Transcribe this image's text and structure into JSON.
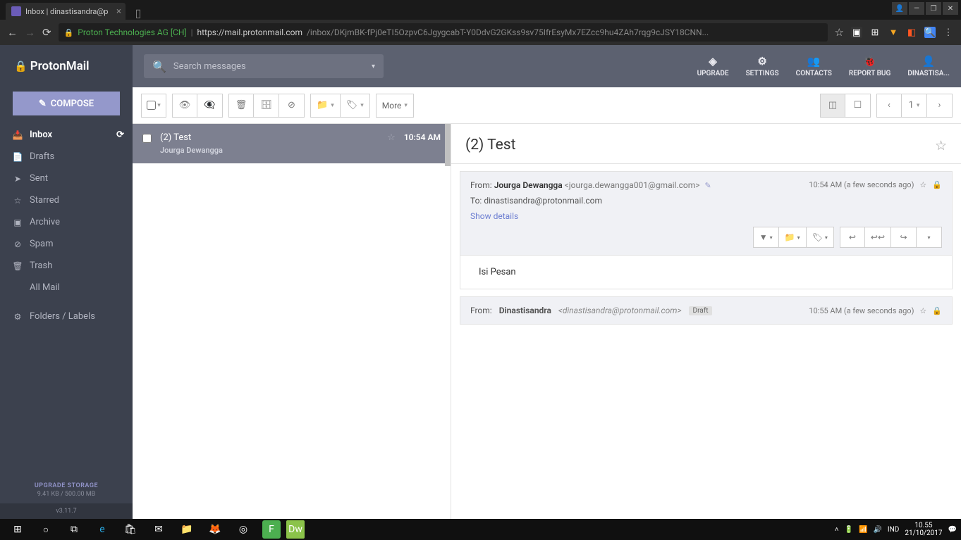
{
  "browser": {
    "tab_title": "Inbox | dinastisandra@p",
    "org": "Proton Technologies AG [CH]",
    "url_host": "https://mail.protonmail.com",
    "url_path": "/inbox/DKjmBK-fPj0eTI5OzpvC6JgygcabT-Y0DdvG2GKss9sv75IfrEsyMx7EZcc9hu4ZAh7rqg9cJSY18CNN..."
  },
  "brand": "ProtonMail",
  "compose_label": "COMPOSE",
  "search_placeholder": "Search messages",
  "top_menu": {
    "upgrade": "UPGRADE",
    "settings": "SETTINGS",
    "contacts": "CONTACTS",
    "report": "REPORT BUG",
    "user": "DINASTISA..."
  },
  "nav": {
    "inbox": "Inbox",
    "drafts": "Drafts",
    "sent": "Sent",
    "starred": "Starred",
    "archive": "Archive",
    "spam": "Spam",
    "trash": "Trash",
    "allmail": "All Mail",
    "folders": "Folders / Labels"
  },
  "storage": {
    "title": "UPGRADE STORAGE",
    "size": "9.41 KB / 500.00 MB"
  },
  "version": "v3.11.7",
  "toolbar": {
    "more": "More",
    "page": "1"
  },
  "list": {
    "item0": {
      "title": "(2) Test",
      "from": "Jourga Dewangga",
      "time": "10:54 AM"
    }
  },
  "detail": {
    "subject": "(2) Test",
    "from_label": "From:",
    "from_name": "Jourga Dewangga",
    "from_addr": "<jourga.dewangga001@gmail.com>",
    "to_label": "To:",
    "to_addr": "dinastisandra@protonmail.com",
    "time": "10:54 AM (a few seconds ago)",
    "show_details": "Show details",
    "body": "Isi Pesan"
  },
  "draft": {
    "from_label": "From:",
    "from_name": "Dinastisandra",
    "from_addr": "<dinastisandra@protonmail.com>",
    "badge": "Draft",
    "time": "10:55 AM (a few seconds ago)"
  },
  "taskbar": {
    "lang": "IND",
    "time": "10.55",
    "date": "21/10/2017"
  }
}
